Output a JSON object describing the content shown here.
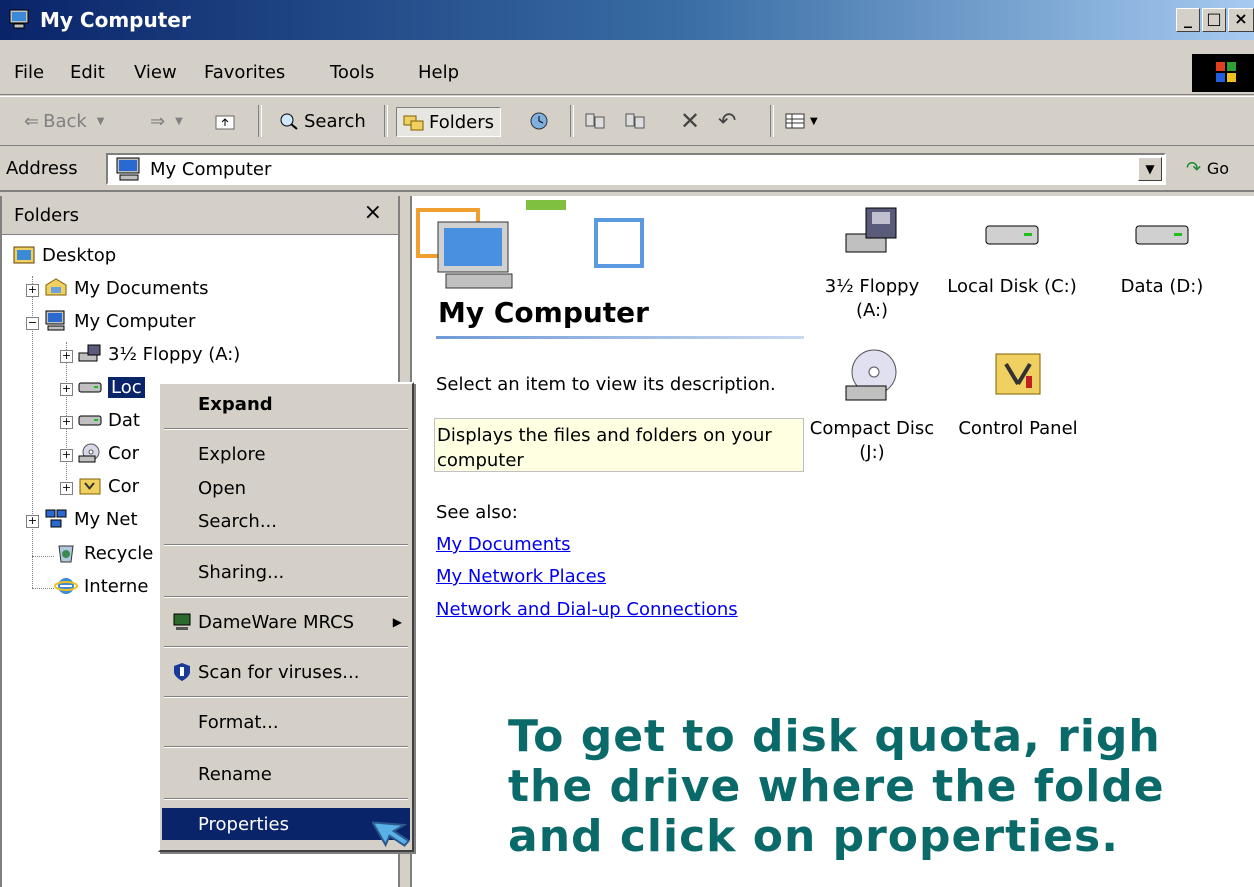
{
  "window": {
    "title": "My Computer"
  },
  "menubar": {
    "items": [
      "File",
      "Edit",
      "View",
      "Favorites",
      "Tools",
      "Help"
    ]
  },
  "toolbar": {
    "back": "Back",
    "search": "Search",
    "folders": "Folders"
  },
  "address": {
    "label": "Address",
    "value": "My Computer",
    "go": "Go"
  },
  "folders_pane": {
    "title": "Folders",
    "close": "×",
    "tree": [
      {
        "label": "Desktop",
        "icon": "desktop-icon"
      },
      {
        "label": "My Documents",
        "icon": "my-documents-icon"
      },
      {
        "label": "My Computer",
        "icon": "my-computer-icon"
      },
      {
        "label": "3½ Floppy (A:)",
        "icon": "floppy-drive-icon"
      },
      {
        "label": "Loc",
        "icon": "hard-drive-icon"
      },
      {
        "label": "Dat",
        "icon": "hard-drive-icon"
      },
      {
        "label": "Cor",
        "icon": "cd-drive-icon"
      },
      {
        "label": "Cor",
        "icon": "control-panel-icon"
      },
      {
        "label": "My Net",
        "icon": "network-places-icon"
      },
      {
        "label": "Recycle",
        "icon": "recycle-bin-icon"
      },
      {
        "label": "Interne",
        "icon": "internet-explorer-icon"
      }
    ]
  },
  "content": {
    "heading": "My Computer",
    "description": "Select an item to view its description.",
    "tip": "Displays the files and folders on your computer",
    "see_also": "See also:",
    "links": [
      "My Documents",
      "My Network Places",
      "Network and Dial-up Connections"
    ],
    "drives": [
      {
        "label1": "3½ Floppy",
        "label2": "(A:)",
        "icon": "floppy-drive-icon"
      },
      {
        "label1": "Local Disk (C:)",
        "label2": "",
        "icon": "hard-drive-icon"
      },
      {
        "label1": "Data (D:)",
        "label2": "",
        "icon": "hard-drive-icon"
      },
      {
        "label1": "Compact Disc",
        "label2": "(J:)",
        "icon": "cd-drive-icon"
      },
      {
        "label1": "Control Panel",
        "label2": "",
        "icon": "control-panel-icon"
      }
    ]
  },
  "context_menu": {
    "items": [
      "Expand",
      "Explore",
      "Open",
      "Search...",
      "Sharing...",
      "DameWare MRCS",
      "Scan for viruses...",
      "Format...",
      "Rename",
      "Properties"
    ]
  },
  "overlay": {
    "line1": "To get to disk quota, righ",
    "line2": "the drive where the folde",
    "line3": "and click on properties."
  },
  "colors": {
    "selection": "#0a246a",
    "overlay_text": "#0a6a6a",
    "tooltip_bg": "#ffffe1"
  }
}
